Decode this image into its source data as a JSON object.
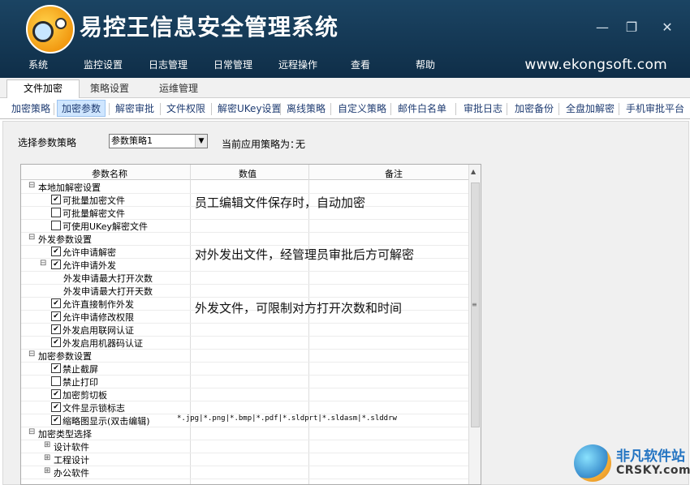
{
  "app": {
    "title": "易控王信息安全管理系统",
    "website": "www.ekongsoft.com"
  },
  "window_controls": {
    "min": "—",
    "max": "❐",
    "close": "✕"
  },
  "menu": [
    "系统",
    "监控设置",
    "日志管理",
    "日常管理",
    "远程操作",
    "查看",
    "帮助"
  ],
  "tabs_level1": [
    "文件加密",
    "策略设置",
    "运维管理"
  ],
  "tabs_level2": [
    "加密策略",
    "加密参数",
    "解密审批",
    "文件权限",
    "解密UKey设置",
    "离线策略",
    "自定义策略",
    "邮件白名单",
    "审批日志",
    "加密备份",
    "全盘加解密",
    "手机审批平台"
  ],
  "policy": {
    "label": "选择参数策略",
    "selected": "参数策略1",
    "current_label": "当前应用策略为：",
    "current_value": "无"
  },
  "grid": {
    "headers": [
      "参数名称",
      "数值",
      "备注"
    ],
    "rows": [
      {
        "label": "本地加解密设置",
        "type": "group",
        "exp": "⊟"
      },
      {
        "label": "可批量加密文件",
        "type": "check",
        "checked": true
      },
      {
        "label": "可批量解密文件",
        "type": "check",
        "checked": false
      },
      {
        "label": "可使用UKey解密文件",
        "type": "check",
        "checked": false
      },
      {
        "label": "外发参数设置",
        "type": "group",
        "exp": "⊟"
      },
      {
        "label": "允许申请解密",
        "type": "check",
        "checked": true
      },
      {
        "label": "允许申请外发",
        "type": "check",
        "checked": true,
        "exp": "⊟"
      },
      {
        "label": "外发申请最大打开次数",
        "type": "sub"
      },
      {
        "label": "外发申请最大打开天数",
        "type": "sub"
      },
      {
        "label": "允许直接制作外发",
        "type": "check",
        "checked": true
      },
      {
        "label": "允许申请修改权限",
        "type": "check",
        "checked": true
      },
      {
        "label": "外发启用联网认证",
        "type": "check",
        "checked": true
      },
      {
        "label": "外发启用机器码认证",
        "type": "check",
        "checked": true
      },
      {
        "label": "加密参数设置",
        "type": "group",
        "exp": "⊟"
      },
      {
        "label": "禁止截屏",
        "type": "check",
        "checked": true
      },
      {
        "label": "禁止打印",
        "type": "check",
        "checked": false
      },
      {
        "label": "加密剪切板",
        "type": "check",
        "checked": true
      },
      {
        "label": "文件显示锁标志",
        "type": "check",
        "checked": true
      },
      {
        "label": "缩略图显示(双击编辑)",
        "type": "check",
        "checked": true,
        "value": "*.jpg|*.png|*.bmp|*.pdf|*.sldprt|*.sldasm|*.slddrw"
      },
      {
        "label": "加密类型选择",
        "type": "group",
        "exp": "⊟"
      },
      {
        "label": "设计软件",
        "type": "subgroup",
        "exp": "⊞"
      },
      {
        "label": "工程设计",
        "type": "subgroup",
        "exp": "⊞"
      },
      {
        "label": "办公软件",
        "type": "subgroup",
        "exp": "⊞"
      }
    ]
  },
  "notes": [
    "员工编辑文件保存时，自动加密",
    "对外发出文件，经管理员审批后方可解密",
    "外发文件，可限制对方打开次数和时间"
  ],
  "watermark": {
    "name": "非凡软件站",
    "domain": "CRSKY.com"
  },
  "colors": {
    "titlebar": "#173d5b",
    "tab_active": "#cfe6ff",
    "link_text": "#1f3c72"
  }
}
